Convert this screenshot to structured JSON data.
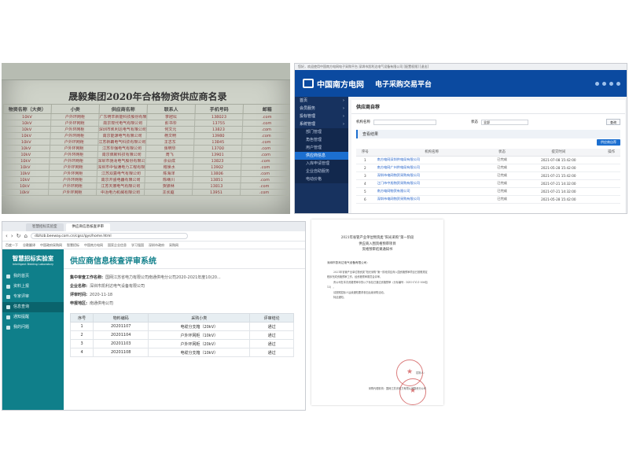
{
  "spreadsheet": {
    "title": "晟毅集团2020年合格物资供应商名录",
    "headers": [
      "物资名称（大类）",
      "小类",
      "供应商名称",
      "联系人",
      "手机号码",
      "邮箱"
    ],
    "rows": [
      [
        "10kV",
        "户外环网柜",
        "广东明丰新能科技股份有限公司",
        "李冠坛",
        "138023",
        ".com"
      ],
      [
        "10kV",
        "户外环网柜",
        "南京现代电气有限公司",
        "彭书华",
        "13755",
        ".com"
      ],
      [
        "10kV",
        "户外环网柜",
        "深圳市凯利达电气有限公司",
        "何文元",
        "13823",
        ".com"
      ],
      [
        "10kV",
        "户外环网柜",
        "南京能源电气有限公司",
        "杨文明",
        "13980",
        ".com"
      ],
      [
        "10kV",
        "户外环网柜",
        "江苏新霸电气科技有限公司",
        "王志东",
        "13845",
        ".com"
      ],
      [
        "10kV",
        "户外环网柜",
        "江苏华强电气有限公司",
        "张明华",
        "13700",
        ".com"
      ],
      [
        "10kV",
        "户外环网柜",
        "南京佩斯科技有限公司",
        "周飞",
        "13901",
        ".com"
      ],
      [
        "10kV",
        "户外环网柜",
        "深圳市驰龙电气股份有限公司",
        "余业成",
        "13823",
        ".com"
      ],
      [
        "10kV",
        "户外环网柜",
        "深圳市中恒通电力工程有限公司",
        "程泉水",
        "13902",
        ".com"
      ],
      [
        "10kV",
        "户外环网柜",
        "江苏双嘉电气有限公司",
        "陈海洋",
        "13806",
        ".com"
      ],
      [
        "10kV",
        "户外环网柜",
        "南京开盛电器有限公司",
        "陈继川",
        "13851",
        ".com"
      ],
      [
        "10kV",
        "户外环网柜",
        "江苏天灏电气有限公司",
        "贺振林",
        "13813",
        ".com"
      ],
      [
        "10kV",
        "户外环网柜",
        "中冶电力机械有限公司",
        "王长庭",
        "13951",
        ".com"
      ]
    ]
  },
  "platform": {
    "topbar": "您好，欢迎使用中国南方电网电子采购平台  深圳市凯利达电气设备有限公司  [配置权限]  [退出]",
    "brand": "中国南方电网",
    "subbrand": "电子采购交易平台",
    "sidebar": [
      {
        "label": "首页",
        "sub": false,
        "active": false
      },
      {
        "label": "会员服务",
        "sub": false,
        "active": false
      },
      {
        "label": "投标管理",
        "sub": false,
        "active": false
      },
      {
        "label": "系统管理",
        "sub": false,
        "active": false
      },
      {
        "label": "部门管理",
        "sub": true,
        "active": false
      },
      {
        "label": "角色管理",
        "sub": true,
        "active": false
      },
      {
        "label": "用户管理",
        "sub": true,
        "active": false
      },
      {
        "label": "供应商信息",
        "sub": true,
        "active": true
      },
      {
        "label": "入库申请管理",
        "sub": true,
        "active": false
      },
      {
        "label": "企业自助服务",
        "sub": true,
        "active": false
      },
      {
        "label": "电动价格",
        "sub": true,
        "active": false
      }
    ],
    "page_title": "供应商自荐",
    "filter_org_label": "机构名称",
    "filter_status_label": "状态",
    "filter_status_value": "全部",
    "query_button": "查询",
    "section_title": "查看结果",
    "action_button": "供应商自荐",
    "columns": [
      "序号",
      "机构名称",
      "状态",
      "提交时间",
      "操作"
    ],
    "rows": [
      [
        "1",
        "南方电网深圳供电局有限公司",
        "已完成",
        "2021-07-08 15:42:00"
      ],
      [
        "2",
        "南方电网广州供电局有限公司",
        "已完成",
        "2021-05-28 15:42:00"
      ],
      [
        "3",
        "深圳市电网物资采购有限公司",
        "已完成",
        "2021-07-21 15:42:00"
      ],
      [
        "4",
        "江门市中旭物资采购有限公司",
        "已完成",
        "2021-07-21 14:32:00"
      ],
      [
        "5",
        "南方电网物资有限公司",
        "已完成",
        "2021-07-21 14:32:00"
      ],
      [
        "6",
        "深圳市电网物资采购有限公司",
        "已完成",
        "2021-05-28 15:42:00"
      ]
    ]
  },
  "browser": {
    "tabs": [
      "智慧招标实验室",
      "供应商信息核查评审"
    ],
    "url": "dlzhzb.beeway.com.cn/cgsc/gys/home.html",
    "bookmarks": [
      "百度一下",
      "谷歌翻译",
      "中国政府采购网",
      "智慧招标",
      "中国南方电网",
      "国家企业信息",
      "学习强国",
      "深圳市政府",
      "采购网"
    ],
    "app_logo": "智慧招标实验室",
    "app_logo_sub": "Intelligent Bidding Laboratory",
    "nav": [
      "我的首页",
      "资料上报",
      "专家评审",
      "信息查询",
      "通知提醒",
      "我的问题"
    ],
    "active_nav": 3,
    "page_title": "供应商信息核查评审系统",
    "info": [
      {
        "label": "集中审查工作名称:",
        "value": "国网江苏省电力有限公司南通供电分公司2020-2021年度10(20..."
      },
      {
        "label": "企业名称:",
        "value": "深圳市凯利达电气设备有限公司"
      },
      {
        "label": "评审时间:",
        "value": "2020-11-18"
      },
      {
        "label": "申报地区:",
        "value": "南通供电公司"
      }
    ],
    "columns": [
      "序号",
      "物料编码",
      "采购小类",
      "评审结论"
    ],
    "rows": [
      [
        "1",
        "20201107",
        "电缆分支箱（20kV）",
        "通过"
      ],
      [
        "2",
        "20201104",
        "户外环网柜（10kV）",
        "通过"
      ],
      [
        "3",
        "20201103",
        "户外环网柜（20kV）",
        "通过"
      ],
      [
        "4",
        "20201108",
        "电缆分支箱（10kV）",
        "通过"
      ]
    ]
  },
  "notice": {
    "title_lines": [
      "2021年省管产业单位物资类“阳光采购”第一阶段",
      "供应商入围资格预审项目",
      "资格预审结果通知书"
    ],
    "to": "深圳市凯利达电气设备有限公司：",
    "body": [
      "2021年省管产业单位物资类“阳光采购”第一阶段供应商入围资格预审项目已按照规定程序完成资格预审工作。经资格预审委员会评审，",
      "贵公司在本次资格预审中的以下标包已通过资格预审（分标编号：DZG-CY21-006包13），",
      "请按照招标人后续通知要求参加后续采购活动。",
      "特此通知。"
    ],
    "sign_org": "招标人：",
    "sign_agent": "采购代理机构：国网江苏省电力有限公司物资分公司"
  }
}
